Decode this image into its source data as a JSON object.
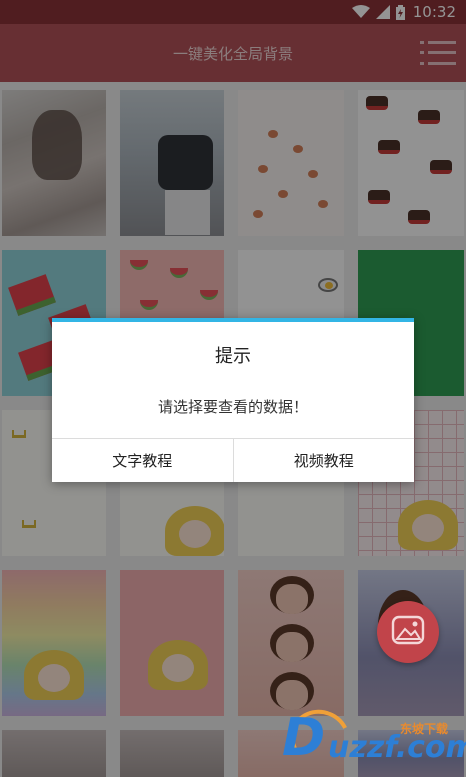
{
  "status_bar": {
    "time": "10:32",
    "icons": [
      "wifi-icon",
      "signal-icon",
      "battery-icon"
    ]
  },
  "header": {
    "title": "一键美化全局背景",
    "menu_icon": "menu-list-icon"
  },
  "dialog": {
    "title": "提示",
    "message": "请选择要查看的数据！",
    "buttons": {
      "text_tutorial": "文字教程",
      "video_tutorial": "视频教程"
    },
    "accent_color": "#33b5e5"
  },
  "fab": {
    "icon": "gallery-icon"
  },
  "watermark": {
    "logo": "uzzf.com",
    "cn": "东坡下载"
  },
  "colors": {
    "title_bar": "#b25258",
    "fab": "#c1444a"
  }
}
